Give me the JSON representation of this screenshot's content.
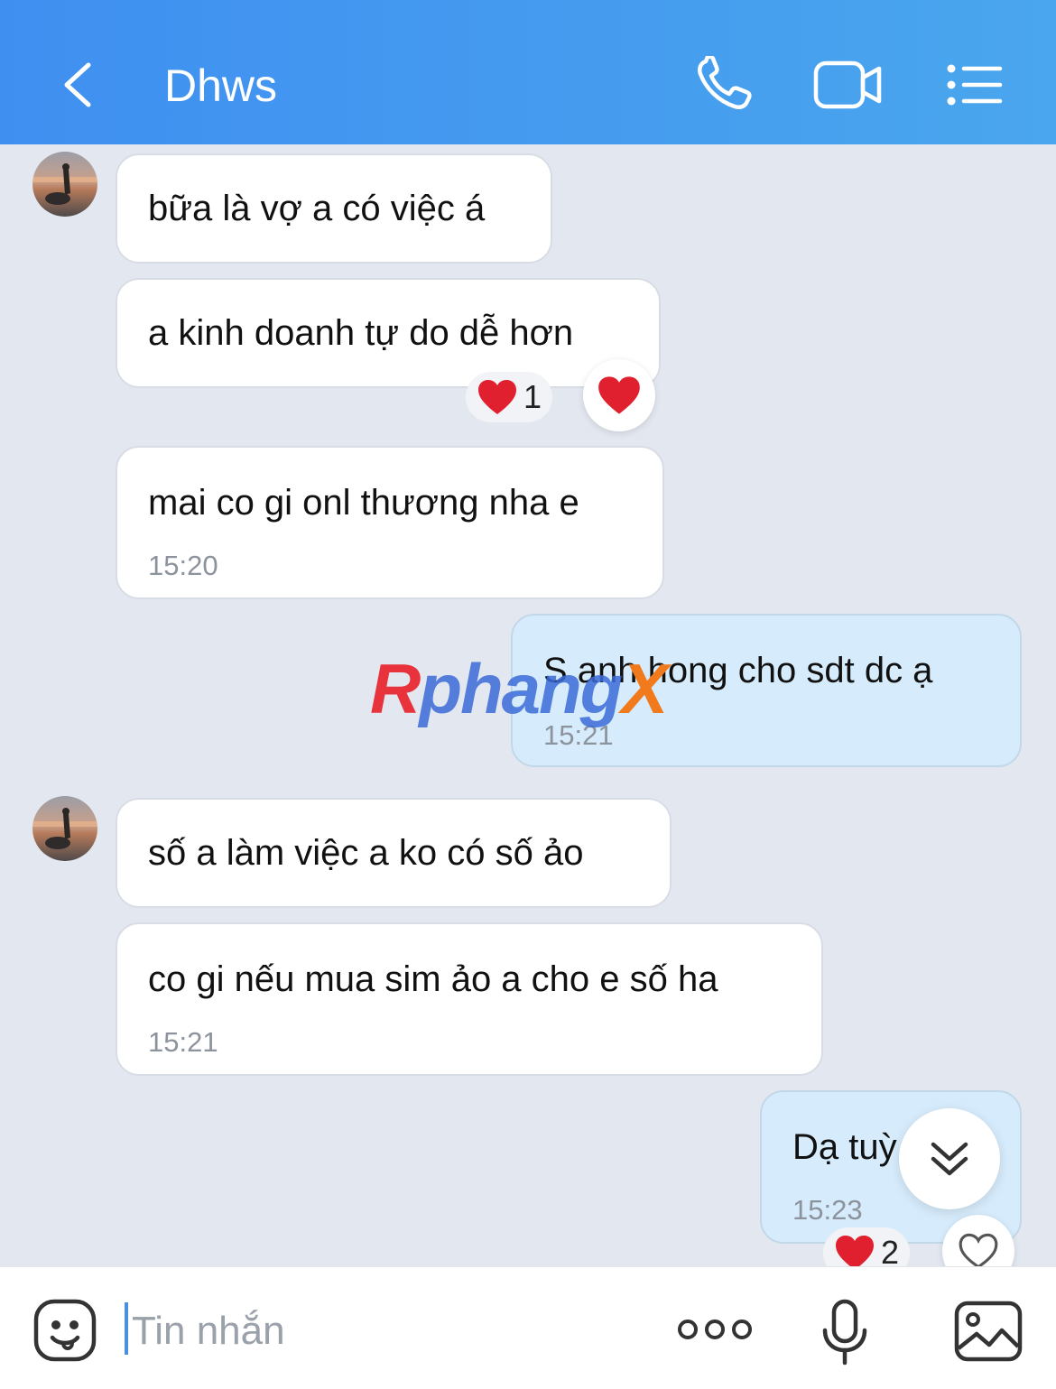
{
  "header": {
    "title": "Dhws",
    "back_icon": "chevron-left-icon",
    "call_icon": "phone-icon",
    "video_icon": "video-camera-icon",
    "menu_icon": "list-menu-icon",
    "bg_color": "#4a96ef"
  },
  "messages": [
    {
      "direction": "incoming",
      "text": "bữa là vợ a có việc á",
      "show_avatar": true
    },
    {
      "direction": "incoming",
      "text": "a kinh doanh tự do dễ hơn",
      "reaction": {
        "emoji": "heart",
        "count": "1"
      }
    },
    {
      "direction": "incoming",
      "text": "mai co gi onl thương nha e",
      "time": "15:20"
    },
    {
      "direction": "outgoing",
      "text": "S anh hong cho sdt dc ạ",
      "time": "15:21"
    },
    {
      "direction": "incoming",
      "text": "số a làm việc a ko có số ảo",
      "show_avatar": true
    },
    {
      "direction": "incoming",
      "text": "co gi nếu mua sim ảo a cho e số ha",
      "time": "15:21"
    },
    {
      "direction": "outgoing",
      "text": "Dạ tuỳ",
      "time": "15:23",
      "reaction": {
        "emoji": "heart",
        "count": "2"
      }
    }
  ],
  "watermark": {
    "r": "R",
    "rest": "phang",
    "x": "X"
  },
  "composer": {
    "placeholder": "Tin nhắn",
    "emoji_icon": "sticker-face-icon",
    "more_icon": "more-dots-icon",
    "mic_icon": "microphone-icon",
    "image_icon": "image-icon"
  },
  "scroll_down_icon": "double-chevron-down-icon"
}
